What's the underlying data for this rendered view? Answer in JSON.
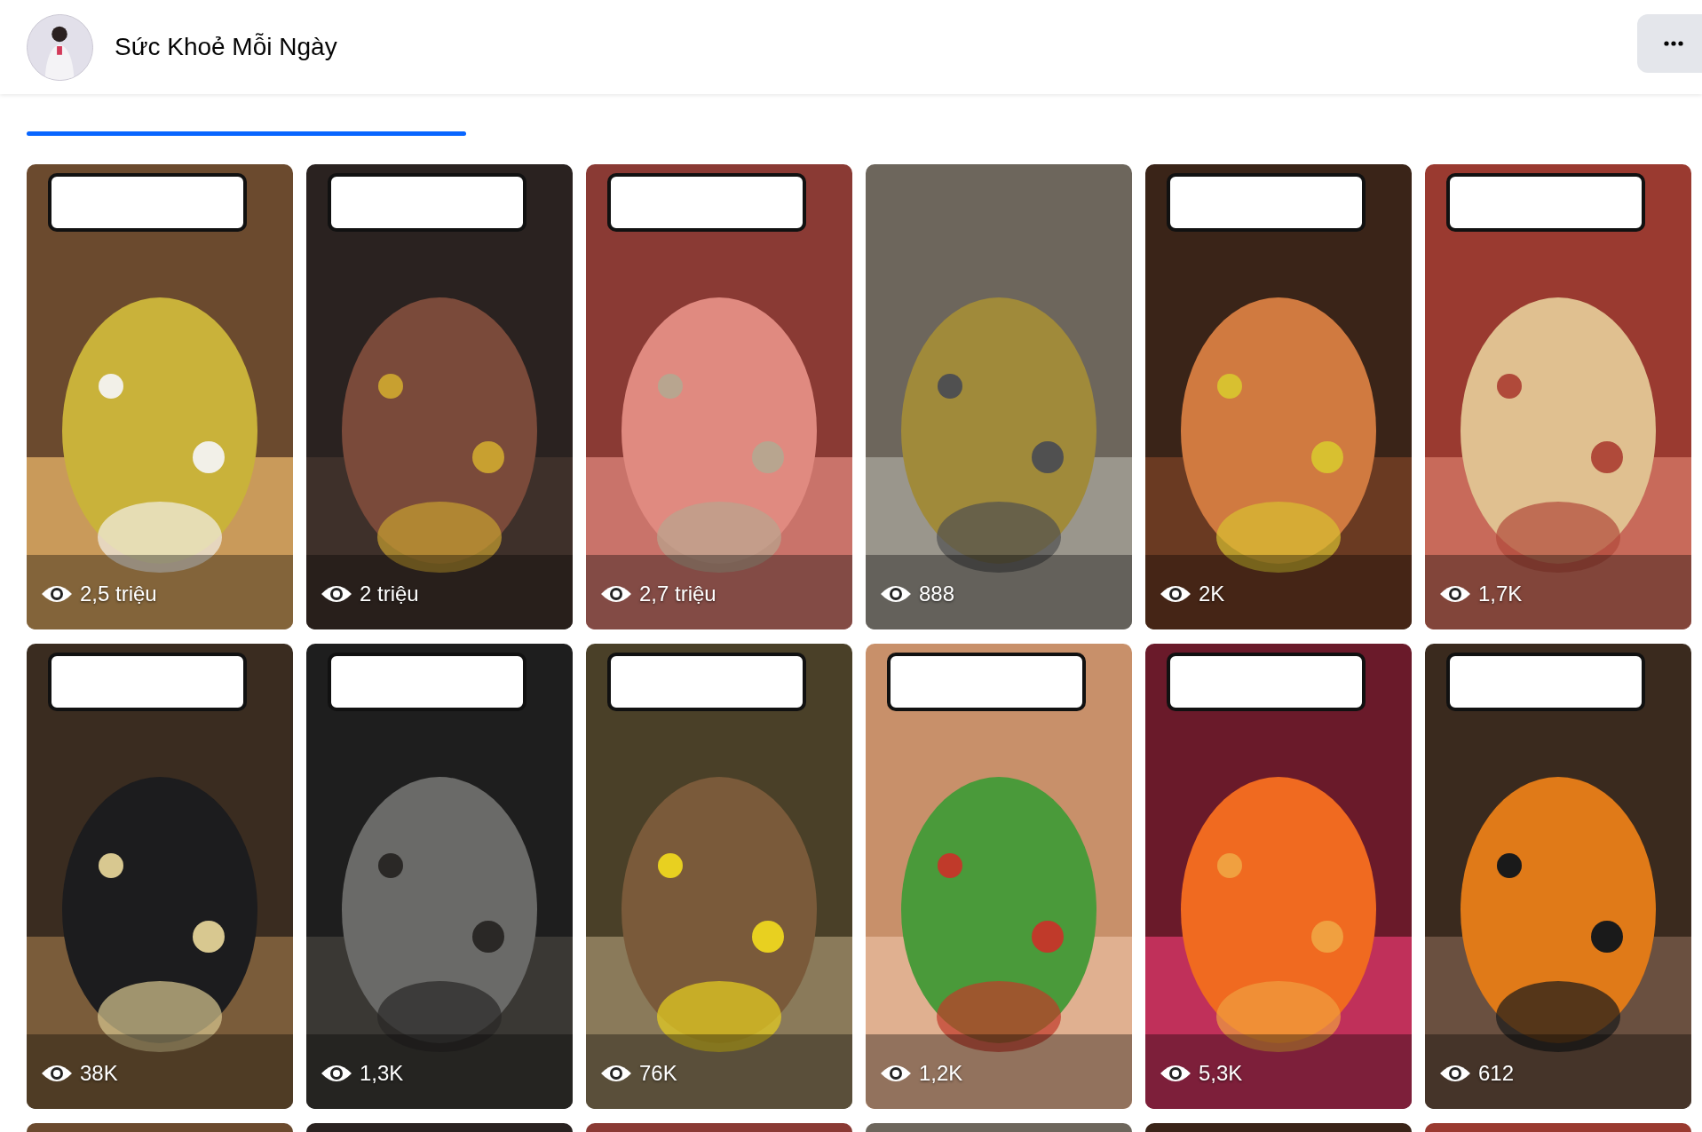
{
  "channel": {
    "name": "Sức Khoẻ Mỗi Ngày"
  },
  "reels": [
    {
      "views": "2,5 triệu"
    },
    {
      "views": "2 triệu"
    },
    {
      "views": "2,7 triệu"
    },
    {
      "views": "888"
    },
    {
      "views": "2K"
    },
    {
      "views": "1,7K"
    },
    {
      "views": "38K"
    },
    {
      "views": "1,3K"
    },
    {
      "views": "76K"
    },
    {
      "views": "1,2K"
    },
    {
      "views": "5,3K"
    },
    {
      "views": "612"
    },
    {
      "kind": "picture"
    },
    {
      "kind": "picture"
    },
    {
      "kind": "picture"
    },
    {
      "kind": "picture"
    },
    {
      "kind": "picture"
    },
    {
      "kind": "picture"
    }
  ]
}
